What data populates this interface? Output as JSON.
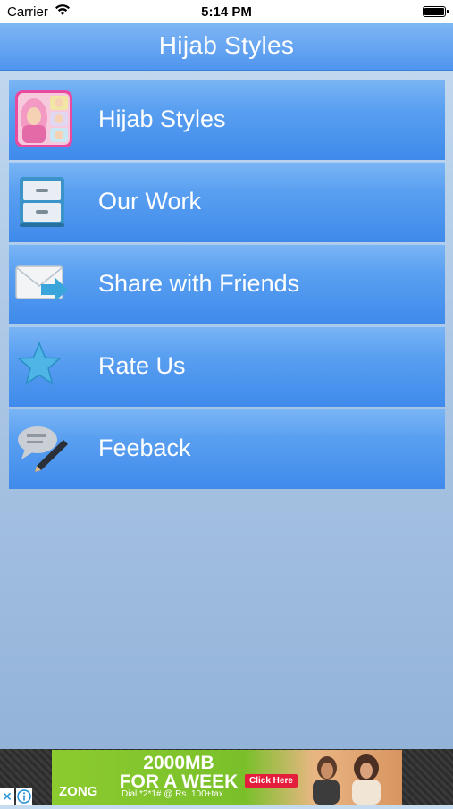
{
  "status_bar": {
    "carrier": "Carrier",
    "time": "5:14 PM"
  },
  "navbar": {
    "title": "Hijab Styles"
  },
  "menu": {
    "items": [
      {
        "label": "Hijab Styles",
        "icon": "hijab-app-icon"
      },
      {
        "label": "Our Work",
        "icon": "cabinet-icon"
      },
      {
        "label": "Share with Friends",
        "icon": "envelope-share-icon"
      },
      {
        "label": "Rate Us",
        "icon": "star-icon"
      },
      {
        "label": "Feeback",
        "icon": "speech-bubble-pen-icon"
      }
    ]
  },
  "ad": {
    "headline_line1": "2000MB",
    "headline_line2": "FOR A WEEK",
    "brand": "ZONG",
    "offer": "Dial *2*1# @ Rs. 100+tax",
    "cta": "Click Here",
    "close_symbol": "✕"
  },
  "colors": {
    "nav_top": "#7fb6f4",
    "nav_bottom": "#4f95ee",
    "row_top": "#7ab5f5",
    "row_bottom": "#3f8aeb",
    "ad_green": "#79c02a"
  }
}
